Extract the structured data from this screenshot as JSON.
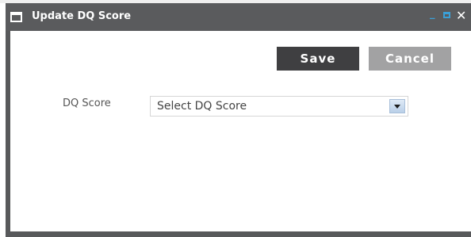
{
  "dialog": {
    "title": "Update DQ Score",
    "icons": {
      "window": "window-icon",
      "minimize": "minimize-icon",
      "maximize": "maximize-icon",
      "close": "close-icon"
    },
    "controls": {
      "minimize": "_",
      "close": "✕"
    }
  },
  "toolbar": {
    "save_label": "Save",
    "cancel_label": "Cancel"
  },
  "form": {
    "dq_score_label": "DQ Score",
    "dq_score_selected": "Select DQ Score"
  },
  "colors": {
    "titlebar": "#5a5b5d",
    "save_button": "#3f3f41",
    "cancel_button": "#a2a2a3",
    "window_controls_accent": "#3aa0d8"
  }
}
